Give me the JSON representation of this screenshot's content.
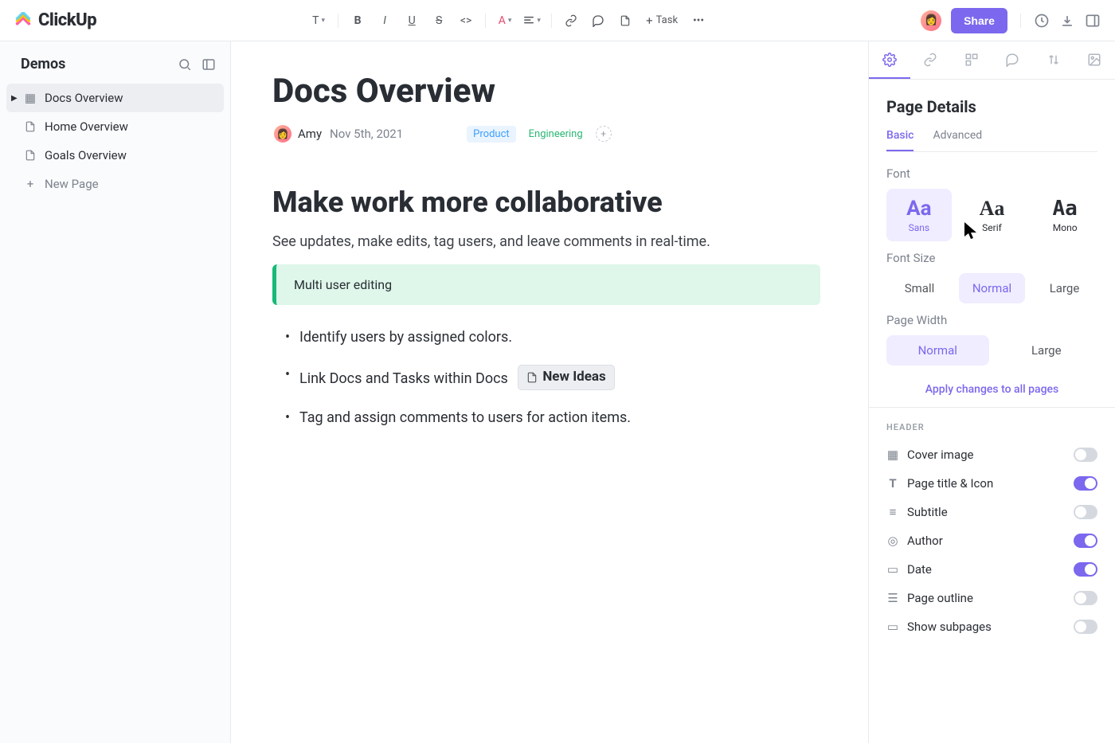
{
  "logo": {
    "text": "ClickUp"
  },
  "toolbar": {
    "task_label": "Task"
  },
  "topright": {
    "share_label": "Share"
  },
  "sidebar": {
    "title": "Demos",
    "items": [
      "Docs Overview",
      "Home Overview",
      "Goals Overview"
    ],
    "new_label": "New Page"
  },
  "doc": {
    "title": "Docs Overview",
    "author": "Amy",
    "date": "Nov 5th, 2021",
    "tag_product": "Product",
    "tag_eng": "Engineering",
    "h2": "Make work more collaborative",
    "p1": "See updates, make edits, tag users, and leave comments in real-time.",
    "callout": "Multi user editing",
    "bullets": {
      "b1": "Identify users by assigned colors.",
      "b2": "Link Docs and Tasks within Docs",
      "b2_link": "New Ideas",
      "b3": "Tag and assign comments to users for action items."
    }
  },
  "panel": {
    "title": "Page Details",
    "subtabs": {
      "basic": "Basic",
      "advanced": "Advanced"
    },
    "font_label": "Font",
    "fonts": {
      "sans": "Sans",
      "serif": "Serif",
      "mono": "Mono",
      "glyph": "Aa"
    },
    "fontsize_label": "Font Size",
    "sizes": {
      "small": "Small",
      "normal": "Normal",
      "large": "Large"
    },
    "width_label": "Page Width",
    "widths": {
      "normal": "Normal",
      "large": "Large"
    },
    "apply": "Apply changes to all pages",
    "header_section": "HEADER",
    "header_rows": {
      "cover": "Cover image",
      "title_icon": "Page title & Icon",
      "subtitle": "Subtitle",
      "author": "Author",
      "date": "Date",
      "outline": "Page outline",
      "subpages": "Show subpages"
    }
  }
}
